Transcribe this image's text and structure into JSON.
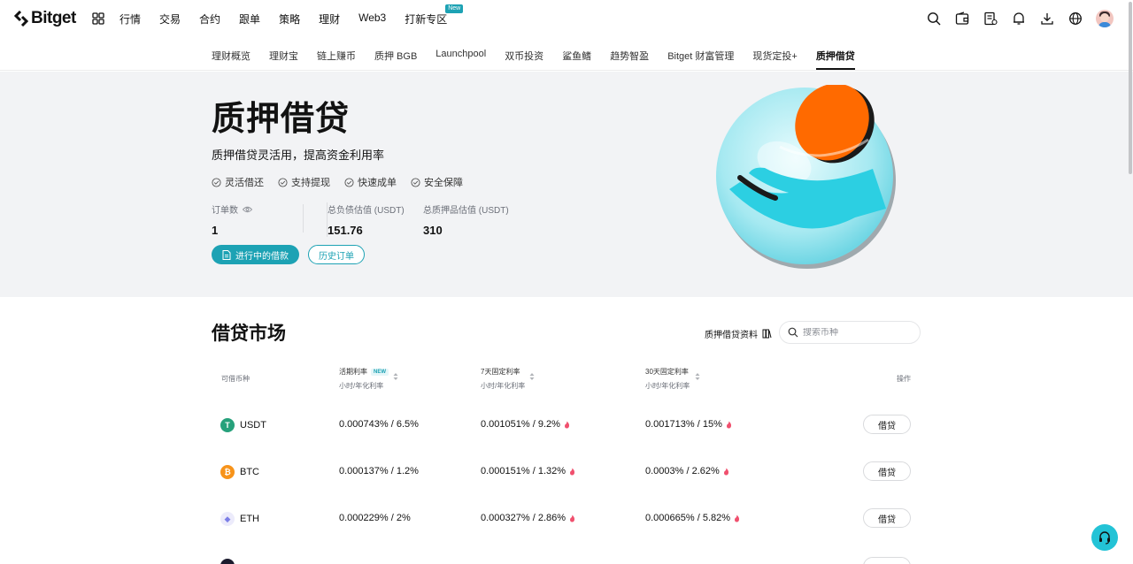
{
  "brand": {
    "name": "Bitget",
    "accent": "#1da2b4",
    "dark": "#121212"
  },
  "topnav": {
    "items": [
      "行情",
      "交易",
      "合约",
      "跟单",
      "策略",
      "理财",
      "Web3",
      "打新专区"
    ],
    "new_badge": "New"
  },
  "subnav": {
    "items": [
      "理财概览",
      "理财宝",
      "链上赚币",
      "质押 BGB",
      "Launchpool",
      "双币投资",
      "鲨鱼鳍",
      "趋势智盈",
      "Bitget 财富管理",
      "现货定投+",
      "质押借贷"
    ],
    "active": "质押借贷"
  },
  "hero": {
    "title": "质押借贷",
    "subtitle": "质押借贷灵活用，提高资金利用率",
    "features": [
      "灵活借还",
      "支持提现",
      "快速成单",
      "安全保障"
    ],
    "stats": [
      {
        "label": "订单数",
        "value": "1"
      },
      {
        "label": "总负债估值 (USDT)",
        "value": "151.76"
      },
      {
        "label": "总质押品估值 (USDT)",
        "value": "310"
      }
    ],
    "btn_active_loans": "进行中的借款",
    "btn_history": "历史订单"
  },
  "market": {
    "title": "借贷市场",
    "doc_link": "质押借贷资料",
    "search_placeholder": "搜索币种",
    "headers": {
      "coin": "可借币种",
      "flex": "活期利率",
      "flex_new": "NEW",
      "fixed7": "7天固定利率",
      "fixed30": "30天固定利率",
      "sub": "小时/年化利率",
      "action": "操作"
    },
    "rows": [
      {
        "coin": "USDT",
        "icon": "usdt-icon",
        "color": "#26a17b",
        "glyph": "T",
        "flex": "0.000743% / 6.5%",
        "fixed7": "0.001051% / 9.2%",
        "fixed30": "0.001713% / 15%",
        "action": "借贷"
      },
      {
        "coin": "BTC",
        "icon": "btc-icon",
        "color": "#f7931a",
        "glyph": "₿",
        "flex": "0.000137% / 1.2%",
        "fixed7": "0.000151% / 1.32%",
        "fixed30": "0.0003% / 2.62%",
        "action": "借贷"
      },
      {
        "coin": "ETH",
        "icon": "eth-icon",
        "color": "#ecebfb",
        "glyph": "◆",
        "flex": "0.000229% / 2%",
        "fixed7": "0.000327% / 2.86%",
        "fixed30": "0.000665% / 5.82%",
        "action": "借贷"
      }
    ]
  }
}
